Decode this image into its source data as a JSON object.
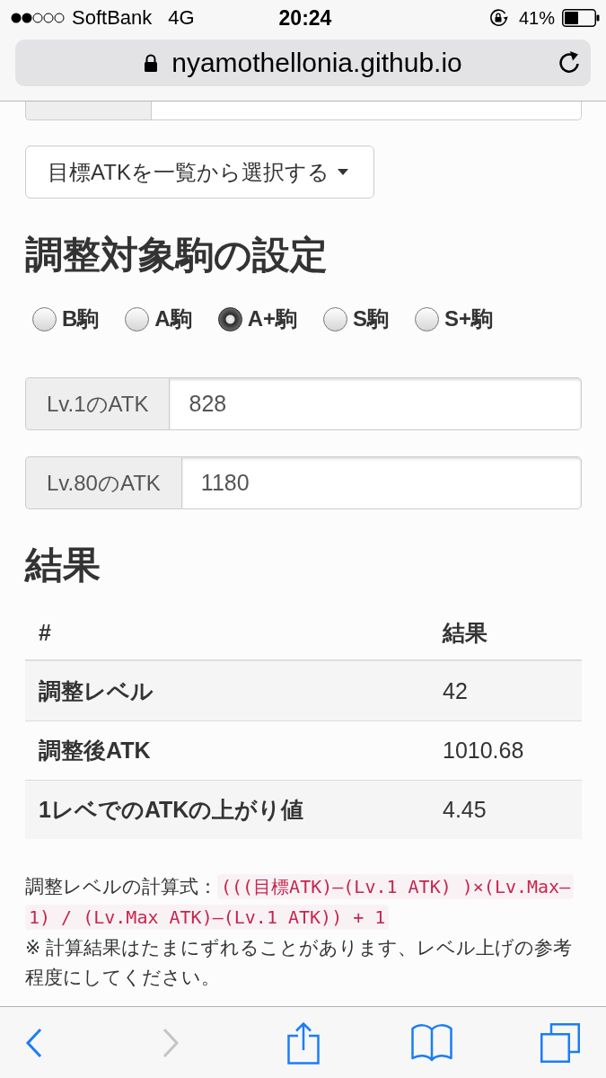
{
  "status_bar": {
    "carrier": "SoftBank",
    "network": "4G",
    "time": "20:24",
    "battery": "41%"
  },
  "address_bar": {
    "url": "nyamothellonia.github.io"
  },
  "target_dropdown": {
    "label": "目標ATKを一覧から選択する"
  },
  "piece_settings": {
    "title": "調整対象駒の設定",
    "options": [
      {
        "label": "B駒",
        "selected": false
      },
      {
        "label": "A駒",
        "selected": false
      },
      {
        "label": "A+駒",
        "selected": true
      },
      {
        "label": "S駒",
        "selected": false
      },
      {
        "label": "S+駒",
        "selected": false
      }
    ]
  },
  "atk_fields": [
    {
      "label": "Lv.1のATK",
      "value": "828"
    },
    {
      "label": "Lv.80のATK",
      "value": "1180"
    }
  ],
  "results": {
    "title": "結果",
    "columns": [
      "#",
      "結果"
    ],
    "rows": [
      {
        "item": "調整レベル",
        "result": "42"
      },
      {
        "item": "調整後ATK",
        "result": "1010.68"
      },
      {
        "item": "1レベでのATKの上がり値",
        "result": "4.45"
      }
    ]
  },
  "notes": {
    "formula_label": "調整レベルの計算式：",
    "formula_lines": [
      "(((目標ATK)–(Lv.1 ATK) )×(Lv.Max–",
      "1) / (Lv.Max ATK)–(Lv.1 ATK)) + 1"
    ],
    "note": "※ 計算結果はたまにずれることがあります、レベル上げの参考程度にしてください。"
  },
  "bottom_toolbar": [
    {
      "kind": "back",
      "disabled": false
    },
    {
      "kind": "forward",
      "disabled": true
    },
    {
      "kind": "share",
      "disabled": false
    },
    {
      "kind": "bookmarks",
      "disabled": false
    },
    {
      "kind": "tabs",
      "disabled": false
    }
  ]
}
